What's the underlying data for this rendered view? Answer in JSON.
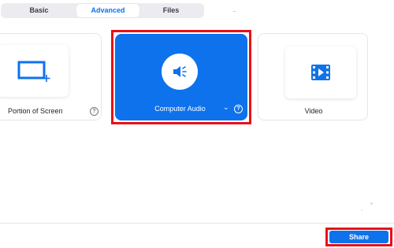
{
  "tabs": [
    {
      "label": "Basic",
      "selected": false
    },
    {
      "label": "Advanced",
      "selected": true
    },
    {
      "label": "Files",
      "selected": false
    }
  ],
  "options": {
    "portion": {
      "label": "Portion of Screen",
      "icon": "portion-screen-icon",
      "help": "?"
    },
    "audio": {
      "label": "Computer Audio",
      "icon": "speaker-icon",
      "help": "?",
      "selected": true
    },
    "video": {
      "label": "Video",
      "icon": "video-icon"
    }
  },
  "footer": {
    "share_label": "Share"
  },
  "colors": {
    "accent": "#0e72ed",
    "highlight": "#e8101a"
  }
}
